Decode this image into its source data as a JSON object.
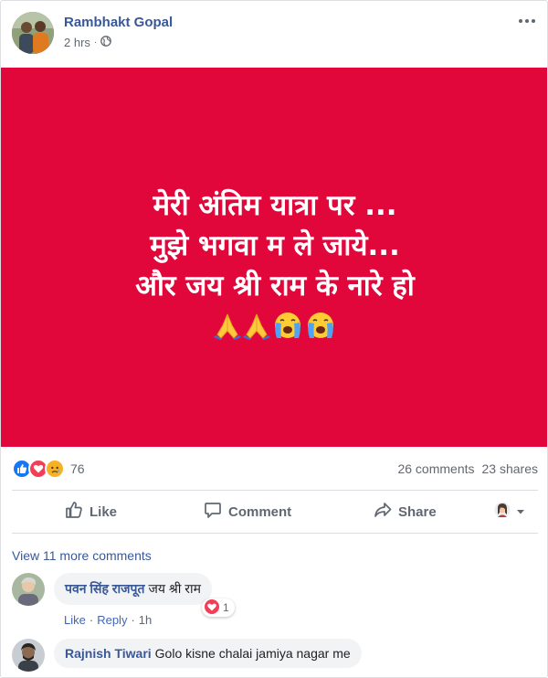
{
  "post": {
    "author": "Rambhakt Gopal",
    "time": "2 hrs",
    "privacy_icon": "globe-icon",
    "image_lines": [
      "मेरी अंतिम यात्रा पर ...",
      "मुझे भगवा म ले जाये...",
      "और जय श्री राम के नारे हो"
    ],
    "image_background": "#e2073b",
    "image_emojis": [
      "folded-hands",
      "folded-hands",
      "loudly-crying-face",
      "loudly-crying-face"
    ]
  },
  "stats": {
    "reactions": [
      "like-reaction",
      "love-reaction",
      "sad-reaction"
    ],
    "reaction_count": "76",
    "comments": "26 comments",
    "shares": "23 shares"
  },
  "actions": {
    "like": "Like",
    "comment": "Comment",
    "share": "Share"
  },
  "comments_section": {
    "view_more": "View 11 more comments",
    "comments": [
      {
        "name": "पवन सिंह राजपूत",
        "text": "जय श्री राम",
        "like_label": "Like",
        "reply_label": "Reply",
        "age": "1h",
        "reaction_count": "1"
      },
      {
        "name": "Rajnish Tiwari",
        "text": "Golo kisne chalai jamiya nagar me"
      }
    ]
  },
  "colors": {
    "link": "#385898",
    "like_blue": "#1877f2",
    "love_red": "#f33e58",
    "sad_yellow": "#f7b125"
  }
}
